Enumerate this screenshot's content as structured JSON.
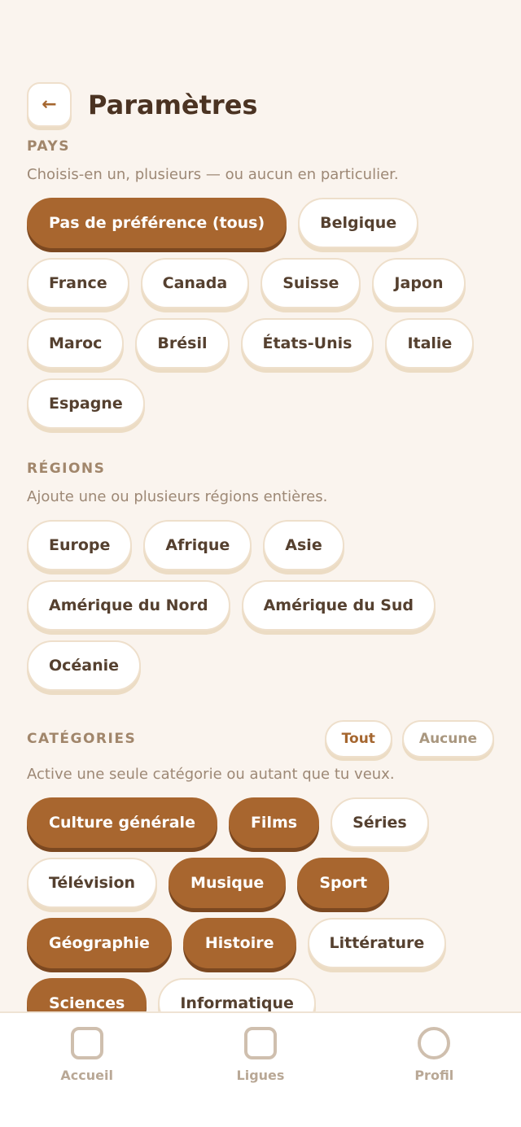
{
  "header": {
    "back_icon": "arrow-left-icon",
    "back_glyph": "←",
    "title": "Paramètres"
  },
  "pays": {
    "label": "PAYS",
    "description": "Choisis-en un, plusieurs — ou aucun en particulier.",
    "chips": [
      {
        "label": "Pas de préférence (tous)",
        "active": true
      },
      {
        "label": "Belgique",
        "active": false
      },
      {
        "label": "France",
        "active": false
      },
      {
        "label": "Canada",
        "active": false
      },
      {
        "label": "Suisse",
        "active": false
      },
      {
        "label": "Japon",
        "active": false
      },
      {
        "label": "Maroc",
        "active": false
      },
      {
        "label": "Brésil",
        "active": false
      },
      {
        "label": "États-Unis",
        "active": false
      },
      {
        "label": "Italie",
        "active": false
      },
      {
        "label": "Espagne",
        "active": false
      }
    ]
  },
  "regions": {
    "label": "RÉGIONS",
    "description": "Ajoute une ou plusieurs régions entières.",
    "chips": [
      {
        "label": "Europe",
        "active": false
      },
      {
        "label": "Afrique",
        "active": false
      },
      {
        "label": "Asie",
        "active": false
      },
      {
        "label": "Amérique du Nord",
        "active": false
      },
      {
        "label": "Amérique du Sud",
        "active": false
      },
      {
        "label": "Océanie",
        "active": false
      }
    ]
  },
  "categories": {
    "label": "CATÉGORIES",
    "all_label": "Tout",
    "none_label": "Aucune",
    "description": "Active une seule catégorie ou autant que tu veux.",
    "chips": [
      {
        "label": "Culture générale",
        "active": true
      },
      {
        "label": "Films",
        "active": true
      },
      {
        "label": "Séries",
        "active": false
      },
      {
        "label": "Télévision",
        "active": false
      },
      {
        "label": "Musique",
        "active": true
      },
      {
        "label": "Sport",
        "active": true
      },
      {
        "label": "Géographie",
        "active": true
      },
      {
        "label": "Histoire",
        "active": true
      },
      {
        "label": "Littérature",
        "active": false
      },
      {
        "label": "Sciences",
        "active": true
      },
      {
        "label": "Informatique",
        "active": false
      }
    ]
  },
  "tabbar": {
    "items": [
      {
        "label": "Accueil",
        "icon": "home-icon"
      },
      {
        "label": "Ligues",
        "icon": "leagues-icon"
      },
      {
        "label": "Profil",
        "icon": "profile-icon"
      }
    ]
  },
  "colors": {
    "accent": "#a8662f",
    "background": "#faf4ee",
    "chip_border": "#eedfcb"
  }
}
